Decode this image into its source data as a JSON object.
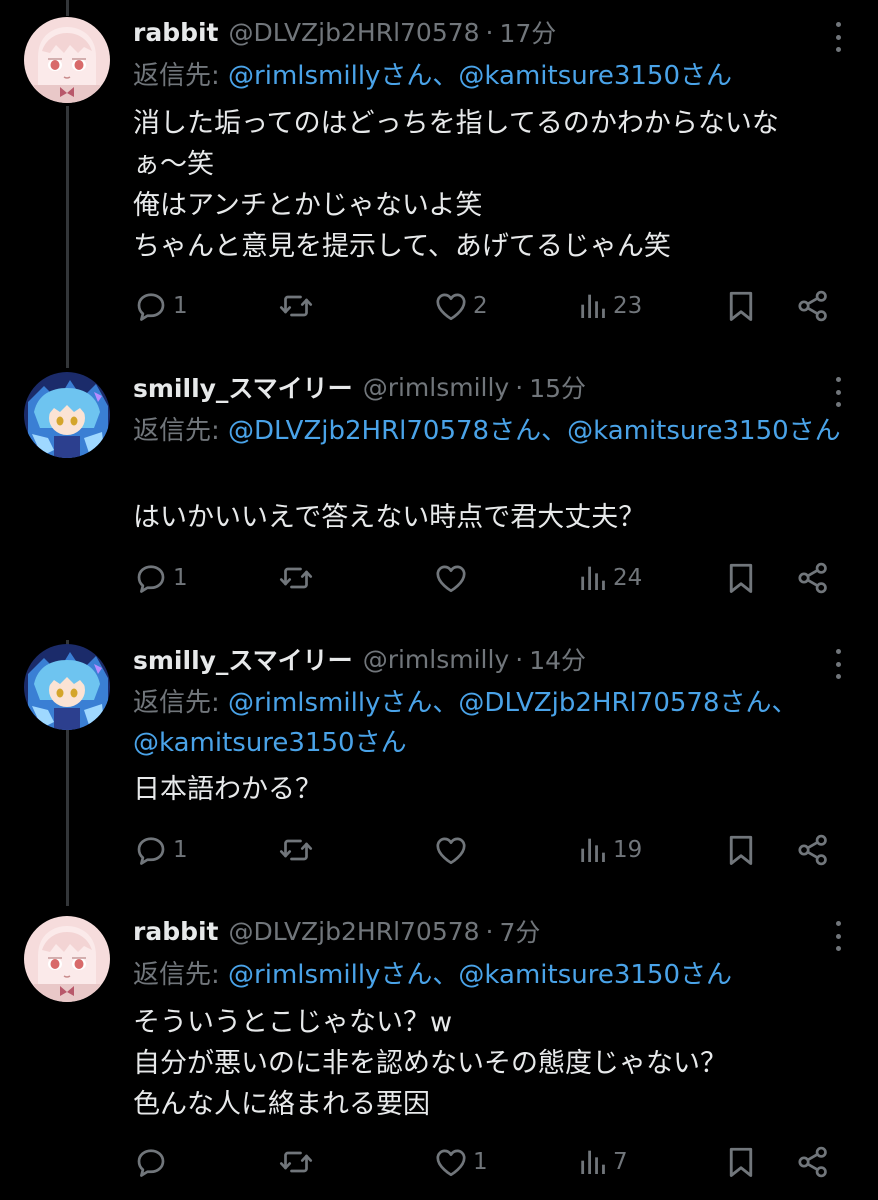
{
  "colors": {
    "background": "#000000",
    "text": "#e7e9ea",
    "muted": "#71767b",
    "mention": "#4aa3e8",
    "thread_line": "#333639"
  },
  "icons": {
    "reply": "speech-bubble",
    "retweet": "repost-arrows",
    "like": "heart-outline",
    "views": "bar-chart",
    "bookmark": "bookmark-outline",
    "share": "share-nodes",
    "more": "vertical-dots"
  },
  "tweets": [
    {
      "display_name": "rabbit",
      "handle": "@DLVZjb2HRl70578",
      "separator": "·",
      "time": "17分",
      "reply_prefix": "返信先: ",
      "reply_mentions": "@rimlsmillyさん、@kamitsure3150さん",
      "body_lines": [
        "消した垢ってのはどっちを指してるのかわからないな",
        "ぁ〜笑",
        "俺はアンチとかじゃないよ笑",
        "ちゃんと意見を提示して、あげてるじゃん笑"
      ],
      "replies": "1",
      "retweets": "",
      "likes": "2",
      "views": "23"
    },
    {
      "display_name": "smilly_スマイリー",
      "handle": "@rimlsmilly",
      "separator": "·",
      "time": "15分",
      "reply_prefix": "返信先: ",
      "reply_mentions": "@DLVZjb2HRl70578さん、@kamitsure3150さん",
      "body_lines": [
        "はいかいいえで答えない時点で君大丈夫？"
      ],
      "replies": "1",
      "retweets": "",
      "likes": "",
      "views": "24"
    },
    {
      "display_name": "smilly_スマイリー",
      "handle": "@rimlsmilly",
      "separator": "·",
      "time": "14分",
      "reply_prefix": "返信先: ",
      "reply_mentions": "@rimlsmillyさん、@DLVZjb2HRl70578さん、@kamitsure3150さん",
      "body_lines": [
        "日本語わかる？"
      ],
      "replies": "1",
      "retweets": "",
      "likes": "",
      "views": "19"
    },
    {
      "display_name": "rabbit",
      "handle": "@DLVZjb2HRl70578",
      "separator": "·",
      "time": "7分",
      "reply_prefix": "返信先: ",
      "reply_mentions": "@rimlsmillyさん、@kamitsure3150さん",
      "body_lines": [
        "そういうとこじゃない？w",
        "自分が悪いのに非を認めないその態度じゃない？",
        "色んな人に絡まれる要因"
      ],
      "replies": "",
      "retweets": "",
      "likes": "1",
      "views": "7"
    }
  ]
}
